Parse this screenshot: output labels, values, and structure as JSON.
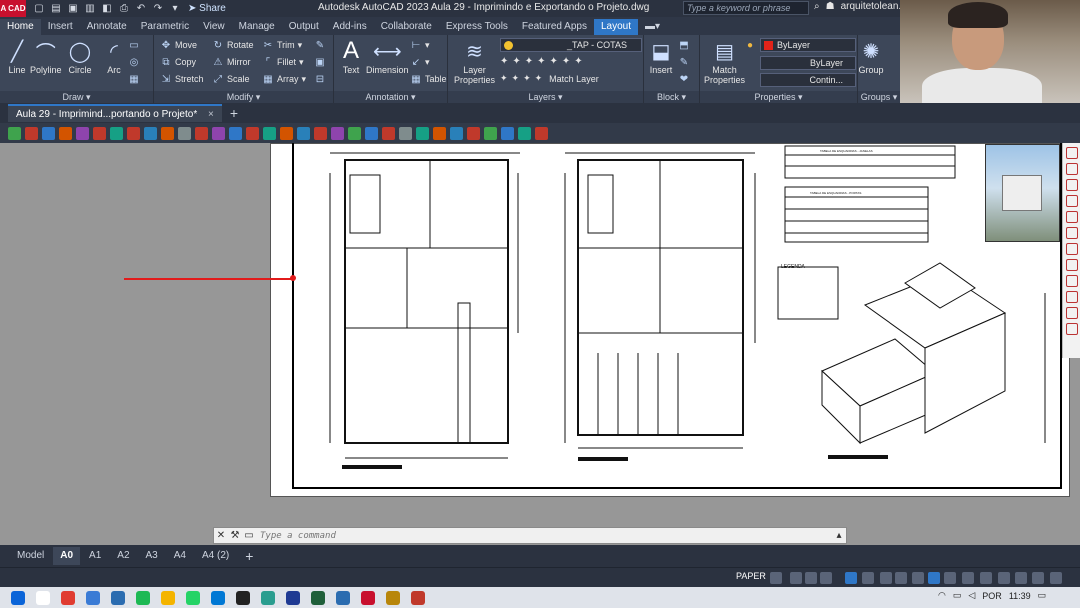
{
  "titlebar": {
    "app_badge": "A CAD",
    "share_label": "Share",
    "window_title": "Autodesk AutoCAD 2023    Aula 29 - Imprimindo e Exportando o Projeto.dwg",
    "search_placeholder": "Type a keyword or phrase",
    "user": "arquitetolean..."
  },
  "ribbon_tabs": [
    "Home",
    "Insert",
    "Annotate",
    "Parametric",
    "View",
    "Manage",
    "Output",
    "Add-ins",
    "Collaborate",
    "Express Tools",
    "Featured Apps",
    "Layout"
  ],
  "ribbon": {
    "draw": {
      "title": "Draw",
      "line": "Line",
      "polyline": "Polyline",
      "circle": "Circle",
      "arc": "Arc"
    },
    "modify": {
      "title": "Modify",
      "move": "Move",
      "rotate": "Rotate",
      "trim": "Trim",
      "copy": "Copy",
      "mirror": "Mirror",
      "fillet": "Fillet",
      "stretch": "Stretch",
      "scale": "Scale",
      "array": "Array"
    },
    "annotation": {
      "title": "Annotation",
      "text": "Text",
      "dimension": "Dimension",
      "table": "Table"
    },
    "layers": {
      "title": "Layers",
      "layer_properties_1": "Layer",
      "layer_properties_2": "Properties",
      "current_layer": "_TAP - COTAS",
      "match_layer": "Match Layer"
    },
    "block": {
      "title": "Block",
      "insert": "Insert"
    },
    "properties": {
      "title": "Properties",
      "match_1": "Match",
      "match_2": "Properties",
      "color": "ByLayer",
      "lineweight": "ByLayer",
      "linetype": "Contin..."
    },
    "groups": {
      "title": "Groups",
      "group": "Group"
    }
  },
  "document_tab": {
    "label": "Aula 29 - Imprimind...portando o Projeto*",
    "close": "×",
    "new": "+"
  },
  "command_line": {
    "placeholder": "Type a command"
  },
  "layout_tabs": [
    "Model",
    "A0",
    "A1",
    "A2",
    "A3",
    "A4",
    "A4 (2)"
  ],
  "layout_add": "+",
  "status": {
    "mode": "PAPER"
  },
  "taskbar": {
    "lang": "POR",
    "time": "11:39"
  },
  "colors": {
    "accent": "#2f77c7",
    "layer_swatch": "#e2231a",
    "redline": "#e21b1b"
  },
  "drawing": {
    "legend_title": "LEGENDA",
    "schedule_table_1": "TABELA DE ESQUADRIAS - JANELAS",
    "schedule_table_2": "TABELA DE ESQUADRIAS - PORTAS"
  }
}
